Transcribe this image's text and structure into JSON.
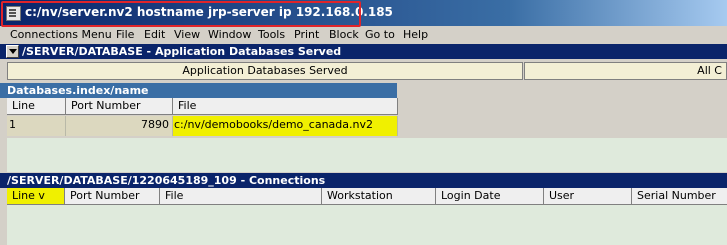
{
  "window": {
    "title": "c:/nv/server.nv2 hostname jrp-server ip 192.168.0.185"
  },
  "menu": [
    "Connections Menu",
    "File",
    "Edit",
    "View",
    "Window",
    "Tools",
    "Print",
    "Block",
    "Go to",
    "Help"
  ],
  "databases_panel": {
    "header": "/SERVER/DATABASE - Application  Databases  Served",
    "tabs": [
      "Application  Databases  Served",
      "All  C"
    ],
    "index_header": "Databases.index/name",
    "columns": [
      "Line",
      "Port Number",
      "File"
    ],
    "rows": [
      {
        "line": "1",
        "port": "7890",
        "file": "c:/nv/demobooks/demo_canada.nv2"
      }
    ]
  },
  "connections_panel": {
    "header": "/SERVER/DATABASE/1220645189_109 - Connections",
    "columns": [
      "Line  v",
      "Port Number",
      "File",
      "Workstation",
      "Login Date",
      "User",
      "Serial Number"
    ]
  },
  "colors": {
    "titlebar": "#0a246a",
    "highlight_box": "#e0242a",
    "selected_cell": "#f0f000",
    "grid_background": "#dfeadc"
  }
}
